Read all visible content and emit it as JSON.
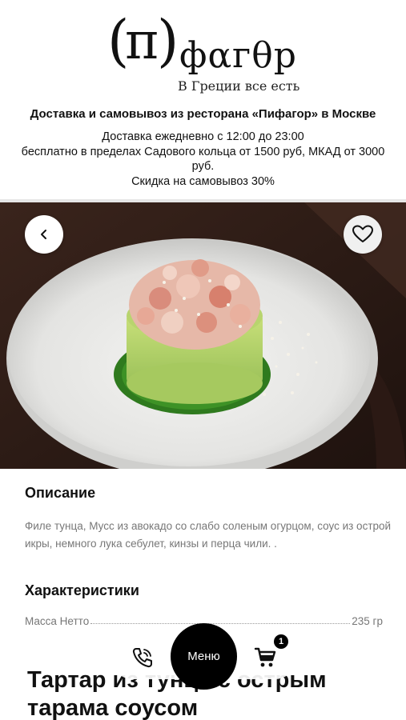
{
  "header": {
    "logo": {
      "paren_open": "(",
      "pi": "π",
      "paren_close": ")",
      "word": "фαгθр"
    },
    "tagline": "В Греции все есть",
    "title": "Доставка и самовывоз из ресторана «Пифагор» в Москве",
    "info": [
      "Доставка ежедневно с 12:00 до 23:00",
      "бесплатно в пределах Садового кольца от 1500 руб, МКАД от 3000 руб.",
      "Скидка на самовывоз 30%"
    ]
  },
  "photo": {
    "alt": "dish-photo"
  },
  "nav": {
    "back_icon": "chevron-left-icon",
    "favorite_icon": "heart-icon"
  },
  "description": {
    "title": "Описание",
    "text": "Филе тунца, Мусс из авокадо со слабо соленым огурцом, соус из острой икры, немного лука себулет, кинзы и перца чили. ."
  },
  "characteristics": {
    "title": "Характеристики",
    "rows": [
      {
        "label": "Масса Нетто",
        "value": "235 гр"
      }
    ]
  },
  "product": {
    "name": "Тартар из тунца с острым тарама соусом"
  },
  "bottom_bar": {
    "phone_icon": "phone-icon",
    "menu_label": "Меню",
    "cart_icon": "cart-icon",
    "cart_count": "1"
  },
  "colors": {
    "accent": "#000000",
    "muted_text": "#777777"
  }
}
